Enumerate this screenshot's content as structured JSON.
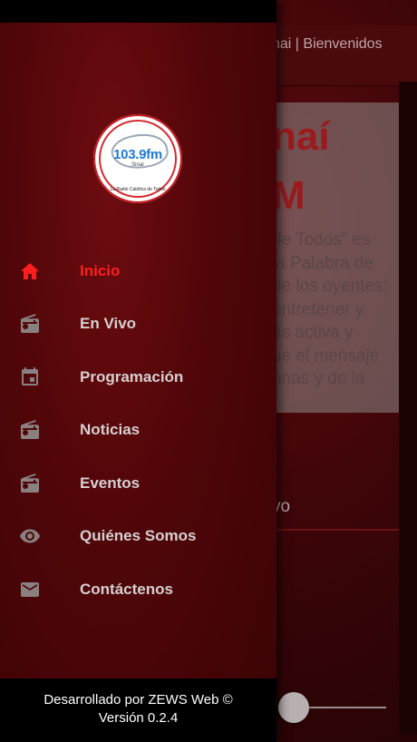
{
  "app": {
    "header_title": "nai | Bienvenidos",
    "hero_title_line1": "naí",
    "hero_title_line2": "M",
    "hero_text_lines": [
      "de Todos” es",
      "la Palabra de",
      "de los oyentes;",
      "entretener y",
      "ás activa y",
      "ue el mensaje",
      "onas y de la"
    ],
    "live_label": "vo"
  },
  "logo": {
    "frequency": "103.9fm",
    "city": "Sinaí",
    "slogan": "La Radio Católica de Todos"
  },
  "menu": {
    "items": [
      {
        "label": "Inicio",
        "icon": "home-icon",
        "active": true
      },
      {
        "label": "En Vivo",
        "icon": "radio-icon",
        "active": false
      },
      {
        "label": "Programación",
        "icon": "calendar-icon",
        "active": false
      },
      {
        "label": "Noticias",
        "icon": "radio-icon",
        "active": false
      },
      {
        "label": "Eventos",
        "icon": "radio-icon",
        "active": false
      },
      {
        "label": "Quiénes Somos",
        "icon": "eye-icon",
        "active": false
      },
      {
        "label": "Contáctenos",
        "icon": "mail-icon",
        "active": false
      }
    ]
  },
  "footer": {
    "line1": "Desarrollado por ZEWS Web ©",
    "line2": "Versión 0.2.4"
  },
  "colors": {
    "accent": "#ff1e1e",
    "icon_gray": "#8a8080",
    "drawer_bg": "#520609"
  }
}
